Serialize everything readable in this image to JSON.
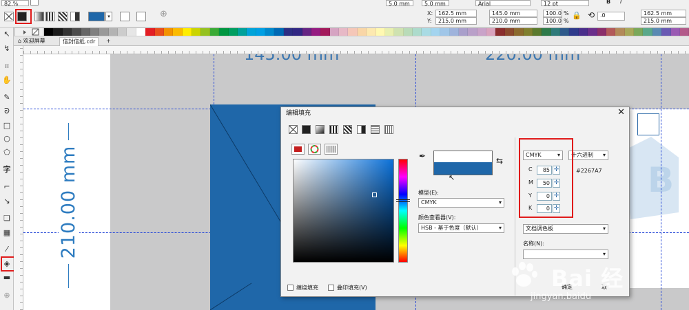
{
  "propbar": {
    "zoom_partial": "82.%",
    "font_name": "Arial",
    "font_size": "12 pt",
    "x_label": "X:",
    "x_value": "162.5 mm",
    "y_label": "Y:",
    "y_value": "215.0 mm",
    "width_value": "145.0 mm",
    "height_value": "210.0 mm",
    "scale_w": "100.0",
    "scale_h": "100.0",
    "pct": "%",
    "rotation": ".0",
    "right_x": "162.5 mm",
    "right_y": "215.0 mm",
    "size_top_partial": "5.0 mm",
    "size_top_partial2": "5.0 mm",
    "bold": "B",
    "italic": "I"
  },
  "palette": [
    "#000000",
    "#1a1a1a",
    "#333333",
    "#4d4d4d",
    "#666666",
    "#808080",
    "#999999",
    "#b3b3b3",
    "#cccccc",
    "#e6e6e6",
    "#ffffff",
    "#e31e24",
    "#e94e1b",
    "#f39200",
    "#fbba00",
    "#ffed00",
    "#cbd401",
    "#95c11f",
    "#3aaa35",
    "#009640",
    "#009e60",
    "#00a19a",
    "#00a3d9",
    "#009fe3",
    "#0088cc",
    "#0069b4",
    "#2d2e83",
    "#312783",
    "#662483",
    "#951b81",
    "#a3195b",
    "#d6a4c2",
    "#e7b9c6",
    "#f5c7b8",
    "#f9d6a7",
    "#fde9b0",
    "#fff9b2",
    "#e8f0b0",
    "#cfe2b1",
    "#b9dbb9",
    "#addbcc",
    "#a9dbe4",
    "#a3d4ef",
    "#a0c6e8",
    "#9fb3dc",
    "#a99fcb",
    "#b9a0c9",
    "#c9a3c9",
    "#d9a3bd",
    "#8b2e2e",
    "#8b4a2e",
    "#8b6a2e",
    "#7f7f2e",
    "#5a7a2e",
    "#2e7a4a",
    "#2e7a7a",
    "#2e5a8b",
    "#2e3a8b",
    "#4a2e8b",
    "#6a2e8b",
    "#8b2e6a",
    "#b35a5a",
    "#b38a5a",
    "#a8a85a",
    "#7aa85a",
    "#5aa88a",
    "#5a8ab3",
    "#6a5ab3",
    "#9a5ab3",
    "#b35a8a"
  ],
  "tabs": {
    "welcome": "欢迎屏幕",
    "document": "信封信纸.cdr",
    "add": "+"
  },
  "canvas": {
    "dim_vertical": "210.00 mm",
    "dim_top_left": "145.00 mm",
    "dim_top_right": "220.00 mm"
  },
  "dialog": {
    "title": "编辑填充",
    "close": "✕",
    "model_label": "模型(E):",
    "model_value": "CMYK",
    "viewer_label": "颜色查看器(V):",
    "viewer_value": "HSB - 基于色度（默认）",
    "mode_select": "CMYK",
    "hex_mode": "十六进制",
    "hex_value": "#2267A7",
    "cmyk": [
      {
        "letter": "C",
        "value": "85"
      },
      {
        "letter": "M",
        "value": "50"
      },
      {
        "letter": "Y",
        "value": "0"
      },
      {
        "letter": "K",
        "value": "0"
      }
    ],
    "palette_select": "文档调色板",
    "name_label": "名称(N):",
    "wrap_fill": "缠绕填充",
    "overprint_fill": "叠印填充(V)",
    "ok": "确定",
    "cancel": "取"
  },
  "watermark": {
    "brand": "Bai 经",
    "url": "jingyan.baidu"
  },
  "colors": {
    "accent_blue": "#1f67a9",
    "highlight_red": "#e01b1b"
  }
}
